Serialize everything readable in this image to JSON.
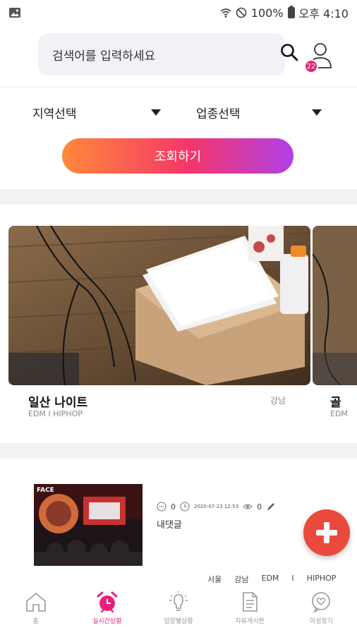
{
  "status_bar": {
    "battery": "100%",
    "time": "오후 4:10"
  },
  "search": {
    "placeholder": "검색어를 입력하세요",
    "notification_count": "22"
  },
  "filters": {
    "region_label": "지역선택",
    "business_label": "업종선택",
    "query_button": "조회하기"
  },
  "featured": [
    {
      "title": "일산 나이트",
      "tags": "EDM I HIPHOP",
      "area": "강남"
    },
    {
      "title": "골",
      "tags": "EDM"
    }
  ],
  "live_post": {
    "comments": "0",
    "date": "2020-07-23 12:53",
    "views": "0",
    "text": "내댓글",
    "tags": [
      "서울",
      "강남",
      "EDM",
      "I",
      "HIPHOP"
    ]
  },
  "bottom_nav": [
    {
      "label": "홈",
      "icon": "home-icon"
    },
    {
      "label": "실시간상황",
      "icon": "alarm-clock-icon",
      "active": true
    },
    {
      "label": "업장별상황",
      "icon": "lightbulb-icon"
    },
    {
      "label": "자유게시판",
      "icon": "document-icon"
    },
    {
      "label": "이성찾기",
      "icon": "heart-chat-icon"
    }
  ],
  "colors": {
    "accent": "#e8207a",
    "gradient_start": "#ff8a3a",
    "gradient_end": "#b040e8",
    "fab": "#ea4a3c"
  }
}
